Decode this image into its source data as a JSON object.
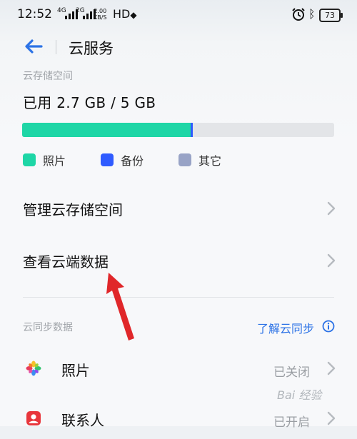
{
  "status_bar": {
    "time": "12:52",
    "signal1": "4G",
    "signal2": "2G",
    "net_speed_value": "2.00",
    "net_speed_unit": "KB/S",
    "hd_label": "HD",
    "battery": "73",
    "icons": [
      "alarm-icon",
      "bluetooth-icon",
      "battery-icon"
    ]
  },
  "header": {
    "title": "云服务",
    "back_icon": "back-arrow-icon"
  },
  "storage": {
    "section_label": "云存储空间",
    "used_text": "已用 2.7 GB / 5 GB",
    "usage": {
      "photos_fraction": 0.54,
      "backup_fraction": 0.007,
      "other_fraction": 0.0
    },
    "legend": [
      {
        "label": "照片",
        "color": "#1ed6a6"
      },
      {
        "label": "备份",
        "color": "#2f5bff"
      },
      {
        "label": "其它",
        "color": "#98a3c6"
      }
    ],
    "manage_label": "管理云存储空间",
    "view_label": "查看云端数据"
  },
  "sync": {
    "section_label": "云同步数据",
    "learn_link": "了解云同步",
    "items": [
      {
        "label": "照片",
        "state": "已关闭",
        "icon": "photos-pinwheel-icon"
      },
      {
        "label": "联系人",
        "state": "已开启",
        "icon": "contacts-icon"
      }
    ]
  },
  "watermark": "Bai 经验",
  "colors": {
    "accent": "#2d73e6",
    "photos": "#1ed6a6",
    "backup": "#2f5bff",
    "other": "#98a3c6",
    "annotation_arrow": "#e0272a"
  }
}
